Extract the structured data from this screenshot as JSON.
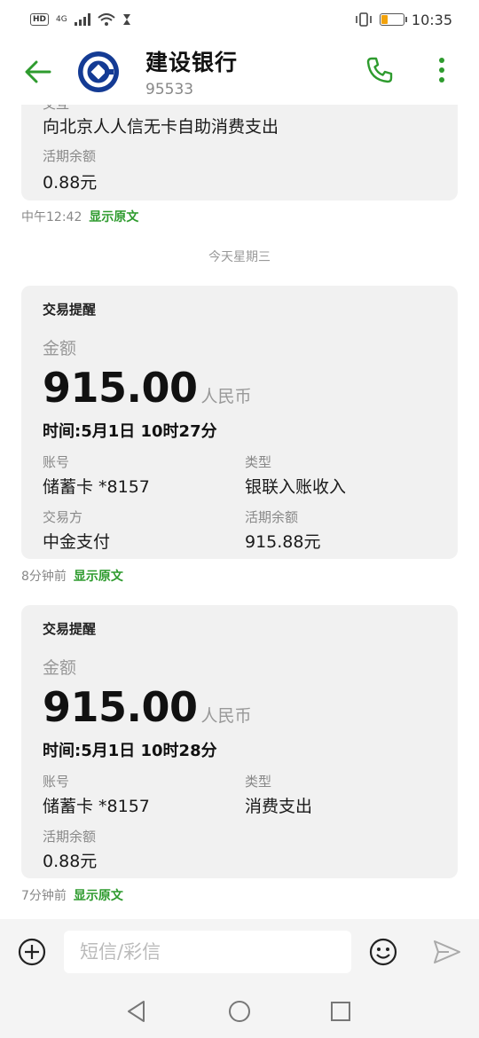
{
  "status_bar": {
    "time": "10:35",
    "hd": "HD",
    "network": "4G"
  },
  "header": {
    "title": "建设银行",
    "number": "95533"
  },
  "messages": {
    "partial": {
      "cut_label": "交互",
      "merchant": "向北京人人信无卡自助消费支出",
      "balance_label": "活期余额",
      "balance": "0.88元",
      "time": "中午12:42",
      "show_original": "显示原文"
    },
    "date_separator": "今天星期三",
    "card1": {
      "title": "交易提醒",
      "amount_label": "金额",
      "amount": "915.00",
      "currency": "人民币",
      "time_line": "时间:5月1日 10时27分",
      "account_label": "账号",
      "account": "储蓄卡 *8157",
      "type_label": "类型",
      "type": "银联入账收入",
      "counterparty_label": "交易方",
      "counterparty": "中金支付",
      "balance_label": "活期余额",
      "balance": "915.88元",
      "age": "8分钟前",
      "show_original": "显示原文"
    },
    "card2": {
      "title": "交易提醒",
      "amount_label": "金额",
      "amount": "915.00",
      "currency": "人民币",
      "time_line": "时间:5月1日 10时28分",
      "account_label": "账号",
      "account": "储蓄卡 *8157",
      "type_label": "类型",
      "type": "消费支出",
      "balance_label": "活期余额",
      "balance": "0.88元",
      "age": "7分钟前",
      "show_original": "显示原文"
    }
  },
  "input_bar": {
    "placeholder": "短信/彩信"
  },
  "colors": {
    "accent_green": "#2e9b2e",
    "bank_blue": "#143b94",
    "card_bg": "#f1f1f1"
  }
}
